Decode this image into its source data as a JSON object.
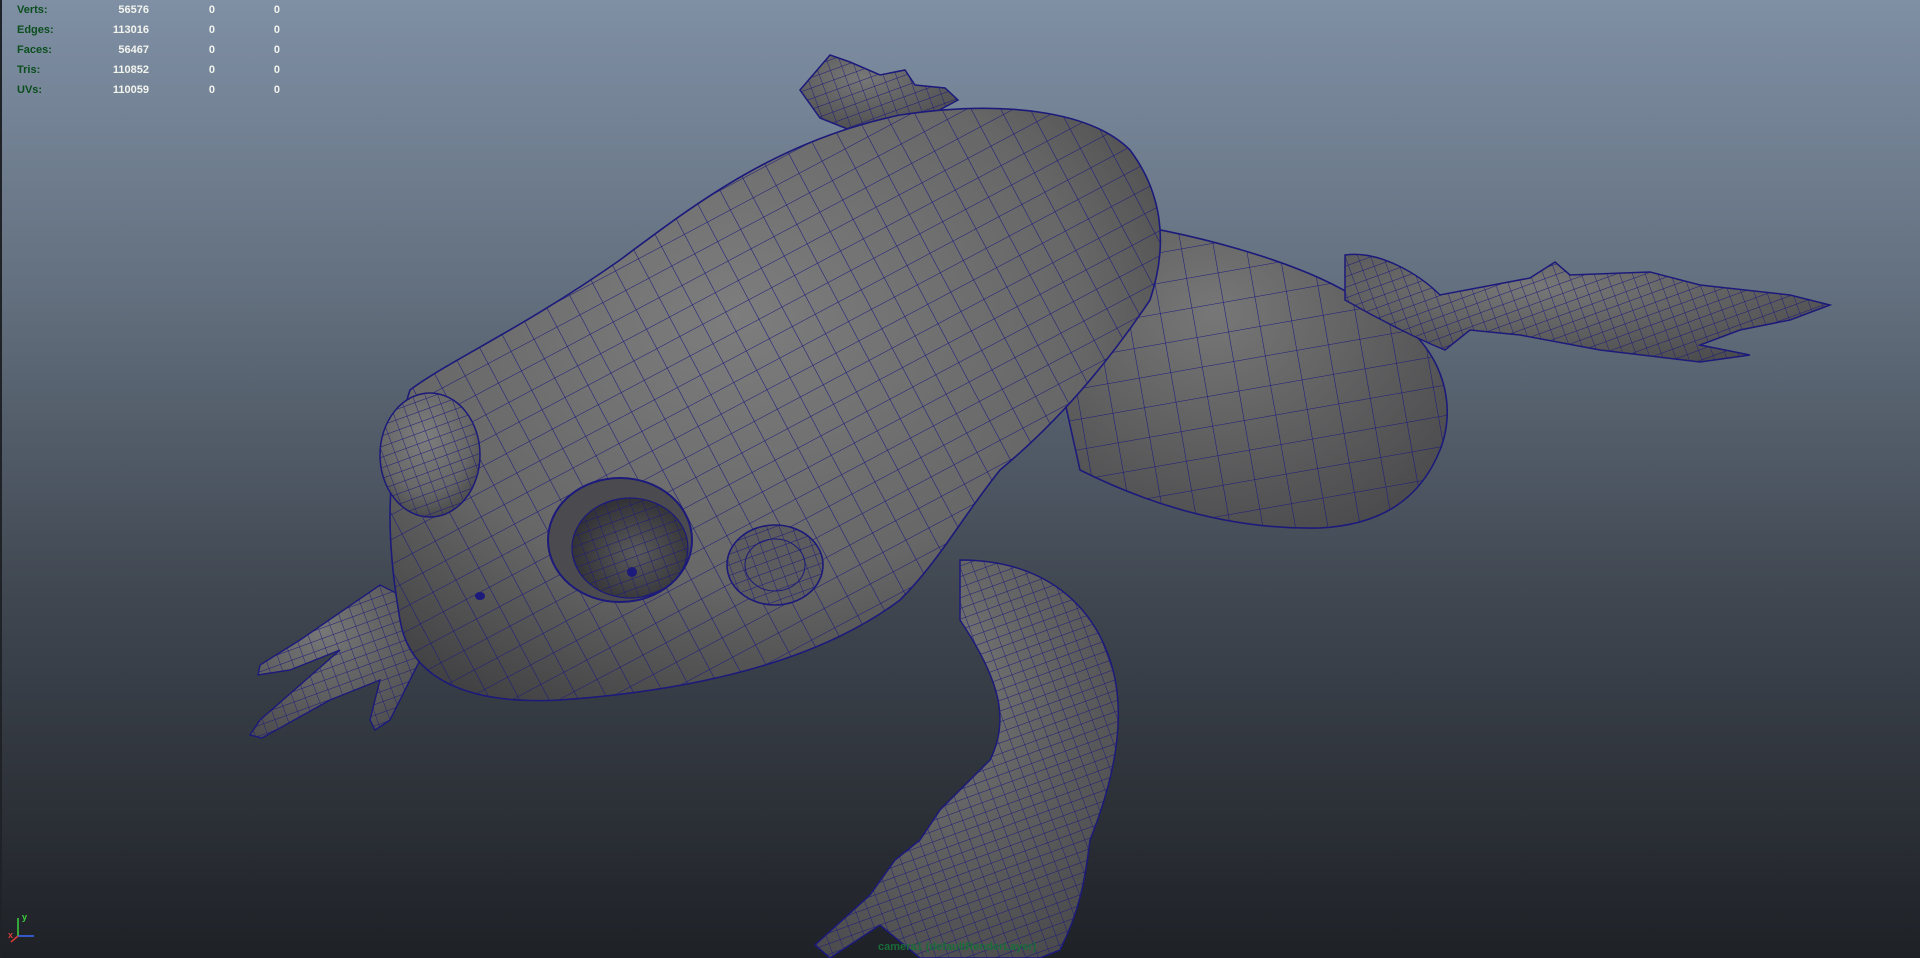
{
  "hud": {
    "rows": [
      {
        "label": "Verts:",
        "v1": "56576",
        "v2": "0",
        "v3": "0"
      },
      {
        "label": "Edges:",
        "v1": "113016",
        "v2": "0",
        "v3": "0"
      },
      {
        "label": "Faces:",
        "v1": "56467",
        "v2": "0",
        "v3": "0"
      },
      {
        "label": "Tris:",
        "v1": "110852",
        "v2": "0",
        "v3": "0"
      },
      {
        "label": "UVs:",
        "v1": "110059",
        "v2": "0",
        "v3": "0"
      }
    ]
  },
  "viewport": {
    "camera_label": "camera1 (defaultRenderLayer)",
    "wire_color": "#1c1a7a",
    "mesh_color": "#6a6a6a",
    "background_top": "#7f8fa4",
    "background_bottom": "#1e2126"
  },
  "axis": {
    "x": "x",
    "y": "y"
  }
}
